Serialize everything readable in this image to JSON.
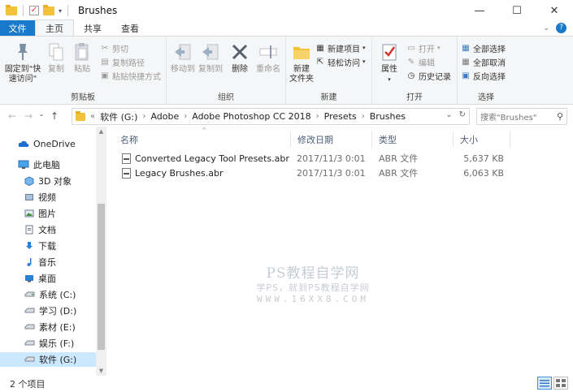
{
  "window": {
    "title": "Brushes",
    "buttons": [
      "minimize",
      "maximize",
      "close"
    ]
  },
  "tabs": [
    {
      "label": "文件",
      "active": false,
      "style": "file"
    },
    {
      "label": "主页",
      "active": true
    },
    {
      "label": "共享",
      "active": false
    },
    {
      "label": "查看",
      "active": false
    }
  ],
  "ribbon": {
    "clipboard": {
      "label": "剪贴板",
      "pin": "固定到\"快速访问\"",
      "copy": "复制",
      "paste": "粘贴",
      "cut": "剪切",
      "copy_path": "复制路径",
      "paste_shortcut": "粘贴快捷方式"
    },
    "organize": {
      "label": "组织",
      "move_to": "移动到",
      "copy_to": "复制到",
      "delete": "删除",
      "rename": "重命名"
    },
    "new": {
      "label": "新建",
      "new_folder": "新建\n文件夹",
      "new_item": "新建项目",
      "easy_access": "轻松访问"
    },
    "open": {
      "label": "打开",
      "properties": "属性",
      "open": "打开",
      "edit": "编辑",
      "history": "历史记录"
    },
    "select": {
      "label": "选择",
      "select_all": "全部选择",
      "select_none": "全部取消",
      "invert": "反向选择"
    }
  },
  "address": {
    "crumbs": [
      "软件 (G:)",
      "Adobe",
      "Adobe Photoshop CC 2018",
      "Presets",
      "Brushes"
    ],
    "search_placeholder": "搜索\"Brushes\""
  },
  "nav": {
    "items": [
      {
        "label": "OneDrive",
        "icon": "cloud-icon"
      },
      {
        "label": "此电脑",
        "icon": "computer-icon"
      },
      {
        "label": "3D 对象",
        "icon": "cube-icon"
      },
      {
        "label": "视频",
        "icon": "video-icon"
      },
      {
        "label": "图片",
        "icon": "picture-icon"
      },
      {
        "label": "文档",
        "icon": "document-icon"
      },
      {
        "label": "下载",
        "icon": "download-icon"
      },
      {
        "label": "音乐",
        "icon": "music-icon"
      },
      {
        "label": "桌面",
        "icon": "desktop-icon"
      },
      {
        "label": "系统 (C:)",
        "icon": "drive-icon"
      },
      {
        "label": "学习 (D:)",
        "icon": "drive-icon"
      },
      {
        "label": "素材 (E:)",
        "icon": "drive-icon"
      },
      {
        "label": "娱乐 (F:)",
        "icon": "drive-icon"
      },
      {
        "label": "软件 (G:)",
        "icon": "drive-icon",
        "selected": true
      }
    ]
  },
  "filelist": {
    "columns": [
      "名称",
      "修改日期",
      "类型",
      "大小"
    ],
    "rows": [
      {
        "name": "Converted Legacy Tool Presets.abr",
        "date": "2017/11/3 0:01",
        "type": "ABR 文件",
        "size": "5,637 KB"
      },
      {
        "name": "Legacy Brushes.abr",
        "date": "2017/11/3 0:01",
        "type": "ABR 文件",
        "size": "6,063 KB"
      }
    ]
  },
  "watermark": {
    "line1": "PS教程自学网",
    "line2": "学PS，就到PS教程自学网",
    "line3": "WWW.16XX8.COM"
  },
  "status": {
    "item_count": "2 个项目"
  },
  "colors": {
    "file_tab": "#1979ca",
    "selection": "#cce8ff",
    "ribbon_bg": "#f5f6f7"
  }
}
